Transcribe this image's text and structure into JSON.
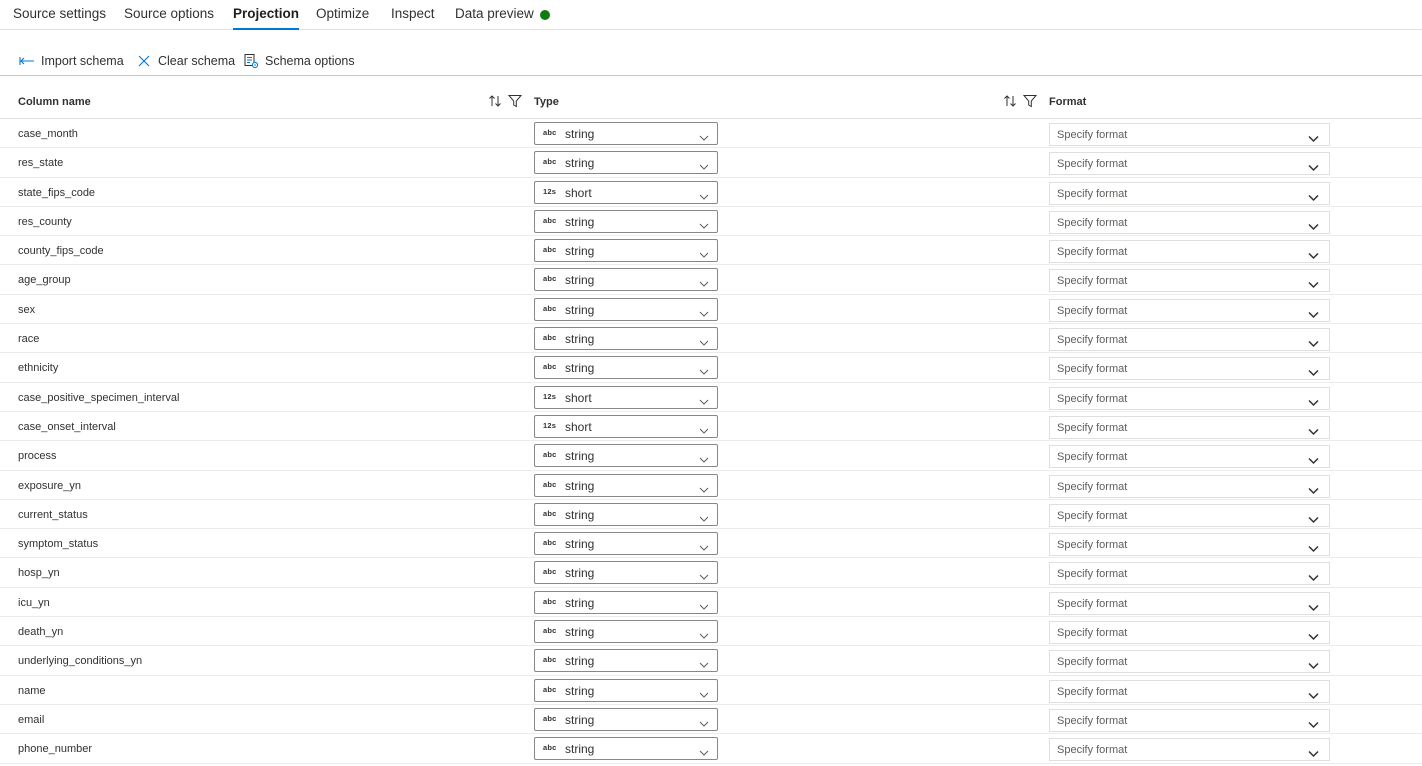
{
  "tabs": [
    {
      "label": "Source settings",
      "active": false
    },
    {
      "label": "Source options",
      "active": false
    },
    {
      "label": "Projection",
      "active": true
    },
    {
      "label": "Optimize",
      "active": false
    },
    {
      "label": "Inspect",
      "active": false
    },
    {
      "label": "Data preview",
      "active": false
    }
  ],
  "data_preview_status_color": "#107c10",
  "accent_color": "#0078d4",
  "toolbar": {
    "import_schema": "Import schema",
    "clear_schema": "Clear schema",
    "schema_options": "Schema options"
  },
  "columns": {
    "name": "Column name",
    "type": "Type",
    "format": "Format"
  },
  "type_icons": {
    "string": "abc",
    "short": "12s"
  },
  "rows": [
    {
      "name": "case_month",
      "type": "string",
      "format_placeholder": "Specify format"
    },
    {
      "name": "res_state",
      "type": "string",
      "format_placeholder": "Specify format"
    },
    {
      "name": "state_fips_code",
      "type": "short",
      "format_placeholder": "Specify format"
    },
    {
      "name": "res_county",
      "type": "string",
      "format_placeholder": "Specify format"
    },
    {
      "name": "county_fips_code",
      "type": "string",
      "format_placeholder": "Specify format"
    },
    {
      "name": "age_group",
      "type": "string",
      "format_placeholder": "Specify format"
    },
    {
      "name": "sex",
      "type": "string",
      "format_placeholder": "Specify format"
    },
    {
      "name": "race",
      "type": "string",
      "format_placeholder": "Specify format"
    },
    {
      "name": "ethnicity",
      "type": "string",
      "format_placeholder": "Specify format"
    },
    {
      "name": "case_positive_specimen_interval",
      "type": "short",
      "format_placeholder": "Specify format"
    },
    {
      "name": "case_onset_interval",
      "type": "short",
      "format_placeholder": "Specify format"
    },
    {
      "name": "process",
      "type": "string",
      "format_placeholder": "Specify format"
    },
    {
      "name": "exposure_yn",
      "type": "string",
      "format_placeholder": "Specify format"
    },
    {
      "name": "current_status",
      "type": "string",
      "format_placeholder": "Specify format"
    },
    {
      "name": "symptom_status",
      "type": "string",
      "format_placeholder": "Specify format"
    },
    {
      "name": "hosp_yn",
      "type": "string",
      "format_placeholder": "Specify format"
    },
    {
      "name": "icu_yn",
      "type": "string",
      "format_placeholder": "Specify format"
    },
    {
      "name": "death_yn",
      "type": "string",
      "format_placeholder": "Specify format"
    },
    {
      "name": "underlying_conditions_yn",
      "type": "string",
      "format_placeholder": "Specify format"
    },
    {
      "name": "name",
      "type": "string",
      "format_placeholder": "Specify format"
    },
    {
      "name": "email",
      "type": "string",
      "format_placeholder": "Specify format"
    },
    {
      "name": "phone_number",
      "type": "string",
      "format_placeholder": "Specify format"
    }
  ]
}
